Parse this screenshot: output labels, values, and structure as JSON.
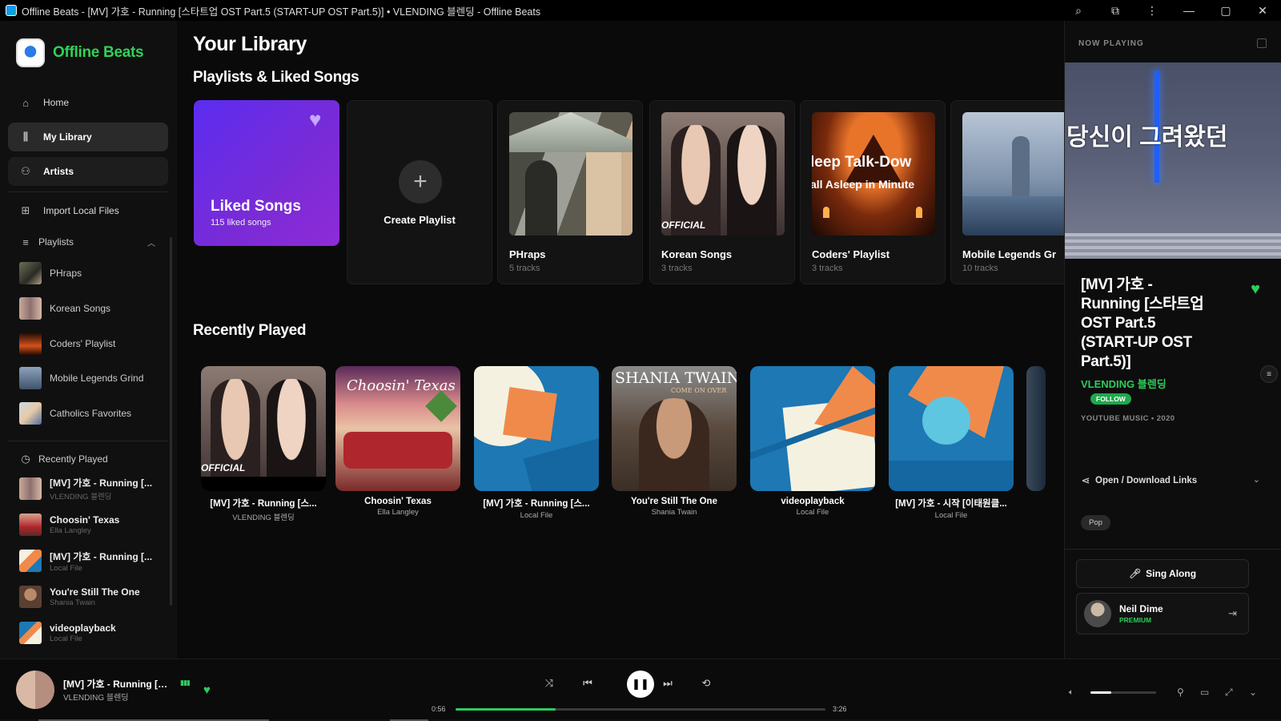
{
  "window": {
    "title": "Offline Beats - [MV] 가호 - Running [스타트업 OST Part.5 (START-UP OST Part.5)] • VLENDING 블렌딩 - Offline Beats",
    "controls": {
      "minimize": "—",
      "maximize": "▢",
      "close": "✕"
    }
  },
  "sidebar": {
    "app_name": "Offline Beats",
    "nav": [
      {
        "label": "Home",
        "icon": "home-icon"
      },
      {
        "label": "My Library",
        "icon": "library-icon",
        "active": true
      },
      {
        "label": "Artists",
        "icon": "artists-icon"
      }
    ],
    "import_label": "Import Local Files",
    "playlists_header": "Playlists",
    "playlists": [
      "PHraps",
      "Korean Songs",
      "Coders' Playlist",
      "Mobile Legends Grind",
      "Catholics Favorites"
    ],
    "recent_header": "Recently Played",
    "recent": [
      {
        "title": "[MV] 가호 - Running [...",
        "sub": "VLENDING 블렌딩"
      },
      {
        "title": "Choosin' Texas",
        "sub": "Ella Langley"
      },
      {
        "title": "[MV] 가호 - Running [...",
        "sub": "Local File"
      },
      {
        "title": "You're Still The One",
        "sub": "Shania Twain"
      },
      {
        "title": "videoplayback",
        "sub": "Local File"
      }
    ]
  },
  "main": {
    "title": "Your Library",
    "playlists_section": "Playlists & Liked Songs",
    "liked": {
      "title": "Liked Songs",
      "sub": "115 liked songs"
    },
    "create_label": "Create Playlist",
    "playlist_cards": [
      {
        "title": "PHraps",
        "sub": "5 tracks"
      },
      {
        "title": "Korean Songs",
        "sub": "3 tracks"
      },
      {
        "title": "Coders' Playlist",
        "sub": "3 tracks"
      },
      {
        "title": "Mobile Legends Gr",
        "sub": "10 tracks"
      }
    ],
    "art_text": {
      "official": "OFFICIAL",
      "sleep1": "leep Talk-Dow",
      "sleep2": "all Asleep in Minute"
    },
    "recent_section": "Recently Played",
    "recent_cards": [
      {
        "title": "[MV] 가호 - Running [스...",
        "sub": "VLENDING 블렌딩"
      },
      {
        "title": "Choosin' Texas",
        "sub": "Ella Langley"
      },
      {
        "title": "[MV] 가호 - Running [스...",
        "sub": "Local File"
      },
      {
        "title": "You're Still The One",
        "sub": "Shania Twain"
      },
      {
        "title": "videoplayback",
        "sub": "Local File"
      },
      {
        "title": "[MV] 가호 - 시작 [이태원클...",
        "sub": "Local File"
      }
    ],
    "recent_art_text": {
      "official": "OFFICIAL",
      "texas": "Choosin' Texas",
      "shania": "SHANIA TWAIN",
      "come_on": "COME ON OVER"
    }
  },
  "now_playing": {
    "header": "NOW PLAYING",
    "art_text": "당신이 그려왔던",
    "title": "[MV] 가호 - Running [스타트업 OST Part.5 (START-UP OST Part.5)]",
    "artist": "VLENDING 블렌딩",
    "follow_label": "FOLLOW",
    "meta": "YOUTUBE MUSIC • 2020",
    "links_label": "Open / Download Links",
    "tag": "Pop",
    "sing_along": "Sing Along",
    "user": {
      "name": "Neil Dime",
      "tier": "PREMIUM"
    }
  },
  "player": {
    "title": "[MV] 가호 - Running [스...",
    "artist": "VLENDING 블렌딩",
    "current_time": "0:56",
    "total_time": "3:26",
    "progress": 0.27,
    "volume": 0.32
  },
  "colors": {
    "accent": "#2ecc5c",
    "liked_gradient_start": "#5b2df0",
    "liked_gradient_end": "#8f2bd8"
  }
}
